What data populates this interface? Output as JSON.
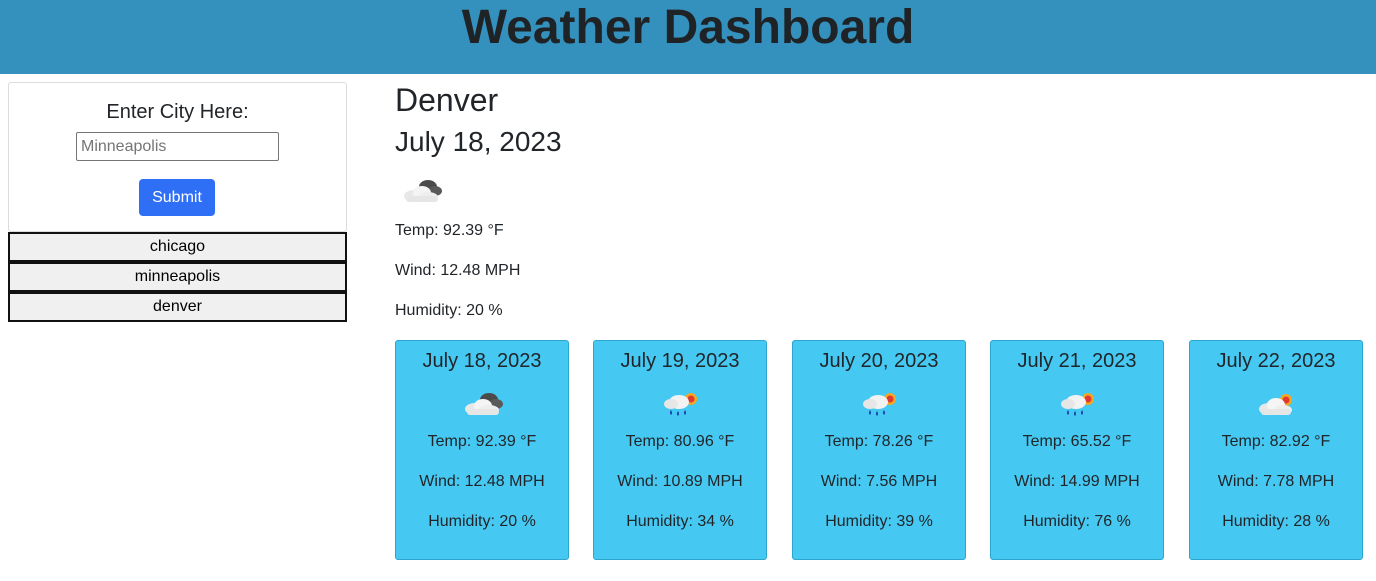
{
  "header": {
    "title": "Weather Dashboard"
  },
  "search": {
    "label": "Enter City Here:",
    "placeholder": "Minneapolis",
    "submit_label": "Submit"
  },
  "history": [
    "chicago",
    "minneapolis",
    "denver"
  ],
  "current": {
    "city": "Denver",
    "date": "July 18, 2023",
    "icon": "cloudy-icon",
    "temp": "Temp: 92.39 °F",
    "wind": "Wind: 12.48 MPH",
    "humidity": "Humidity: 20 %"
  },
  "forecast": [
    {
      "date": "July 18, 2023",
      "icon": "cloudy-icon",
      "temp": "Temp: 92.39 °F",
      "wind": "Wind: 12.48 MPH",
      "humidity": "Humidity: 20 %"
    },
    {
      "date": "July 19, 2023",
      "icon": "rain-sun-icon",
      "temp": "Temp: 80.96 °F",
      "wind": "Wind: 10.89 MPH",
      "humidity": "Humidity: 34 %"
    },
    {
      "date": "July 20, 2023",
      "icon": "rain-sun-icon",
      "temp": "Temp: 78.26 °F",
      "wind": "Wind: 7.56 MPH",
      "humidity": "Humidity: 39 %"
    },
    {
      "date": "July 21, 2023",
      "icon": "rain-sun-icon",
      "temp": "Temp: 65.52 °F",
      "wind": "Wind: 14.99 MPH",
      "humidity": "Humidity: 76 %"
    },
    {
      "date": "July 22, 2023",
      "icon": "partly-sunny-icon",
      "temp": "Temp: 82.92 °F",
      "wind": "Wind: 7.78 MPH",
      "humidity": "Humidity: 28 %"
    }
  ],
  "colors": {
    "header_bg": "#3490bc",
    "card_bg": "#45c9f2",
    "submit_bg": "#2f6ff6"
  }
}
